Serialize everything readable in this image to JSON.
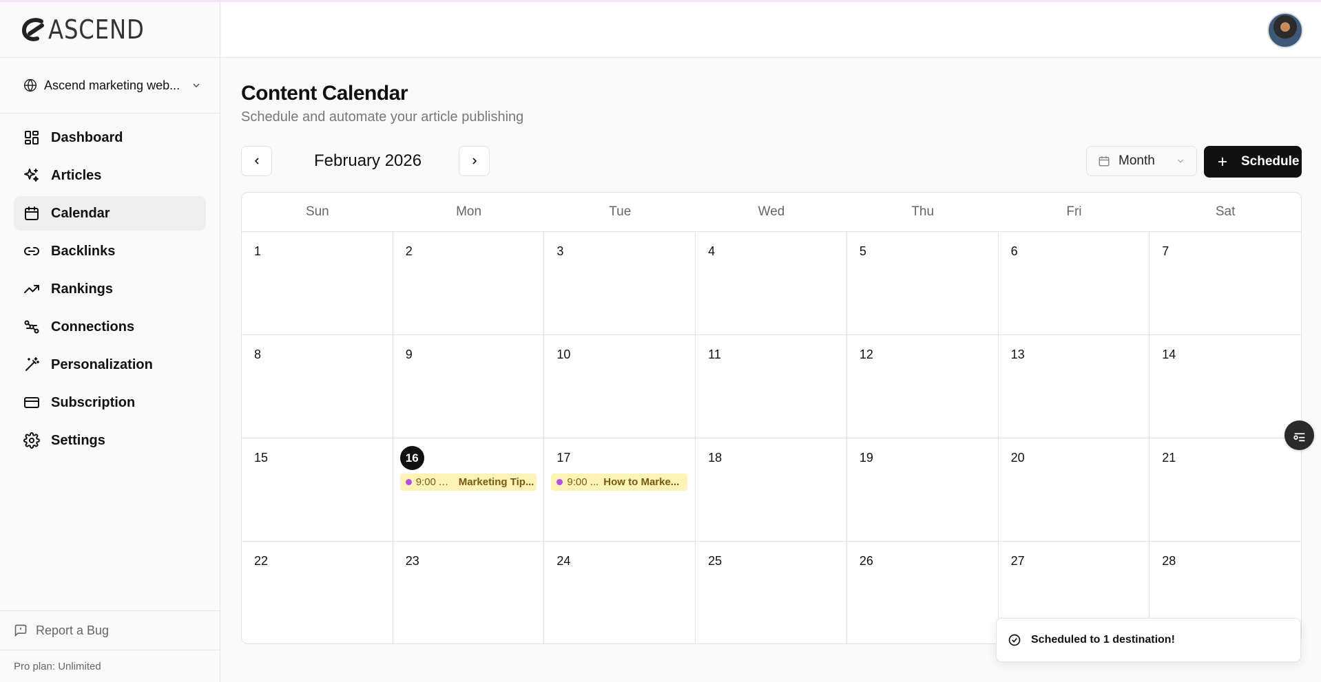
{
  "app": {
    "logo_text": "ASCEND"
  },
  "site_selector": {
    "value": "Ascend marketing web..."
  },
  "sidebar": {
    "items": [
      {
        "label": "Dashboard",
        "icon": "dashboard-icon"
      },
      {
        "label": "Articles",
        "icon": "sparkles-icon"
      },
      {
        "label": "Calendar",
        "icon": "calendar-icon",
        "active": true
      },
      {
        "label": "Backlinks",
        "icon": "link-icon"
      },
      {
        "label": "Rankings",
        "icon": "trending-up-icon"
      },
      {
        "label": "Connections",
        "icon": "connections-icon"
      },
      {
        "label": "Personalization",
        "icon": "wand-icon"
      },
      {
        "label": "Subscription",
        "icon": "credit-card-icon"
      },
      {
        "label": "Settings",
        "icon": "gear-icon"
      }
    ],
    "report_bug": "Report a Bug",
    "plan": "Pro plan: Unlimited"
  },
  "page": {
    "title": "Content Calendar",
    "subtitle": "Schedule and automate your article publishing"
  },
  "toolbar": {
    "month_label": "February 2026",
    "view_value": "Month",
    "schedule_label": "Schedule"
  },
  "calendar": {
    "weekdays": [
      "Sun",
      "Mon",
      "Tue",
      "Wed",
      "Thu",
      "Fri",
      "Sat"
    ],
    "days": [
      "1",
      "2",
      "3",
      "4",
      "5",
      "6",
      "7",
      "8",
      "9",
      "10",
      "11",
      "12",
      "13",
      "14",
      "15",
      "16",
      "17",
      "18",
      "19",
      "20",
      "21",
      "22",
      "23",
      "24",
      "25",
      "26",
      "27",
      "28"
    ],
    "today": "16",
    "events": [
      {
        "day": "16",
        "time": "9:00 A...",
        "title": "Marketing Tip..."
      },
      {
        "day": "17",
        "time": "9:00 ...",
        "title": "How to Marke..."
      }
    ],
    "event_dot_color": "#b44ee6",
    "event_bg_color": "#fdf3b8"
  },
  "toast": {
    "message": "Scheduled to 1 destination!"
  }
}
